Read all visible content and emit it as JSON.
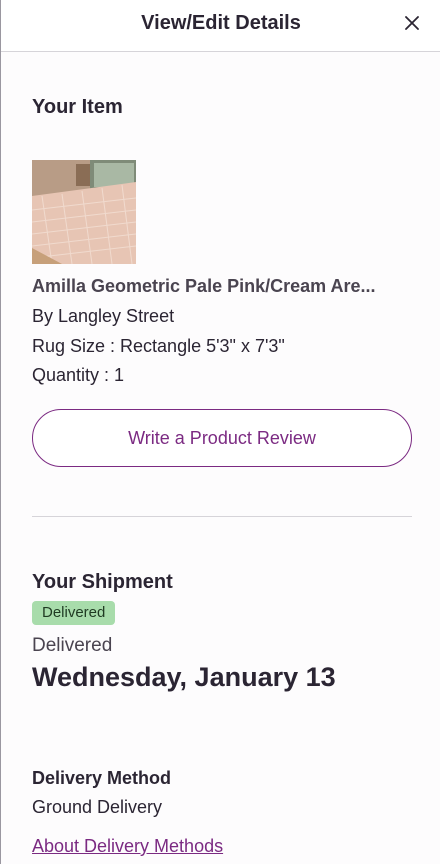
{
  "header": {
    "title": "View/Edit Details",
    "close_icon": "close-icon"
  },
  "item_section": {
    "title": "Your Item",
    "image_icon": "rug-product-image",
    "name": "Amilla Geometric Pale Pink/Cream Are...",
    "brand": "By Langley Street",
    "size": "Rug Size : Rectangle 5'3\" x 7'3\"",
    "quantity": "Quantity : 1",
    "review_button": "Write a Product Review"
  },
  "shipment_section": {
    "title": "Your Shipment",
    "badge": "Delivered",
    "status": "Delivered",
    "date": "Wednesday, January 13"
  },
  "delivery_method": {
    "title": "Delivery Method",
    "value": "Ground Delivery",
    "link": "About Delivery Methods"
  },
  "colors": {
    "accent": "#7b2a82",
    "badge_bg": "#a8dcab",
    "text": "#2b2533"
  }
}
